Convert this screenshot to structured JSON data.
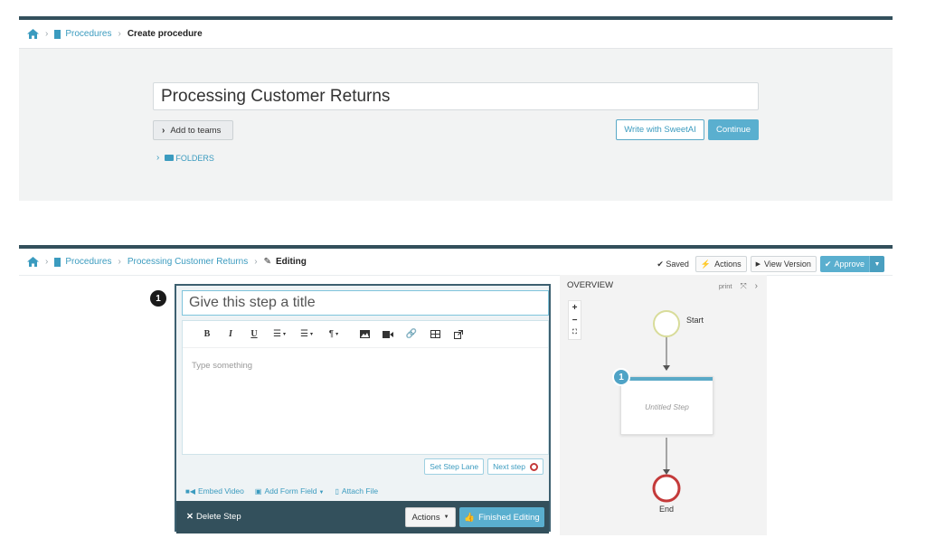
{
  "create": {
    "breadcrumb": {
      "procedures": "Procedures",
      "current": "Create procedure"
    },
    "title_value": "Processing Customer Returns",
    "add_teams": "Add to teams",
    "folders": "FOLDERS",
    "write_ai": "Write with SweetAI",
    "continue": "Continue"
  },
  "edit": {
    "breadcrumb": {
      "procedures": "Procedures",
      "procedure": "Processing Customer Returns",
      "current": "Editing"
    },
    "toolbar": {
      "saved": "Saved",
      "actions": "Actions",
      "view_version": "View Version",
      "approve": "Approve"
    },
    "step": {
      "number": "1",
      "title_placeholder": "Give this step a title",
      "body_placeholder": "Type something",
      "set_step_lane": "Set Step Lane",
      "next_step": "Next step",
      "embed_video": "Embed Video",
      "add_form_field": "Add Form Field",
      "attach_file": "Attach File",
      "delete_step": "Delete Step",
      "actions": "Actions",
      "finished_editing": "Finished Editing"
    },
    "overview": {
      "title": "OVERVIEW",
      "print": "print",
      "start": "Start",
      "end": "End",
      "step_label": "Untitled Step",
      "step_number": "1"
    }
  },
  "colors": {
    "accent": "#5aafcf",
    "dark": "#33505c",
    "start_ring": "#d8dc9a",
    "end_ring": "#c43a3a"
  }
}
